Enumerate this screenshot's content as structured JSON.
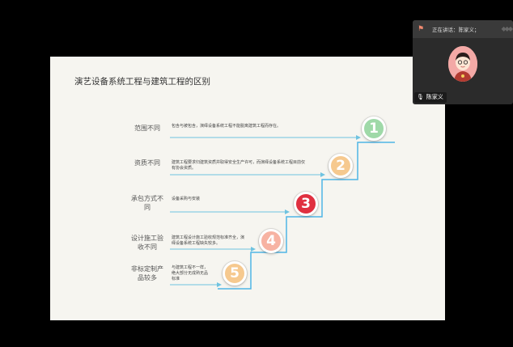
{
  "slide": {
    "title": "演艺设备系统工程与建筑工程的区别",
    "rows": [
      {
        "label": "范围不同",
        "desc": "包含与被包含，演绎设备系统工程不能脱离建筑工程而存在。",
        "number": "1",
        "color": "#9fd9a8"
      },
      {
        "label": "资质不同",
        "desc": "建筑工程要求归建筑资质并取得安全生产许可，而演绎设备系统工程目前仅有协会资质。",
        "number": "2",
        "color": "#f6c98f"
      },
      {
        "label": "承包方式不同",
        "desc": "设备采购与安装",
        "number": "3",
        "color": "#e03040"
      },
      {
        "label": "设计施工验收不同",
        "desc": "建筑工程设计施工验收规范标准齐全，演绎设备系统工程缺失较多。",
        "number": "4",
        "color": "#f7b3a3"
      },
      {
        "label": "非标定制产品较多",
        "desc": "与建筑工程不一样，绝大部分无成熟无品标准",
        "number": "5",
        "color": "#f6c98f"
      }
    ]
  },
  "meeting": {
    "speaking_label": "正在讲话：陈家义；",
    "participant_name": "陈家义"
  }
}
